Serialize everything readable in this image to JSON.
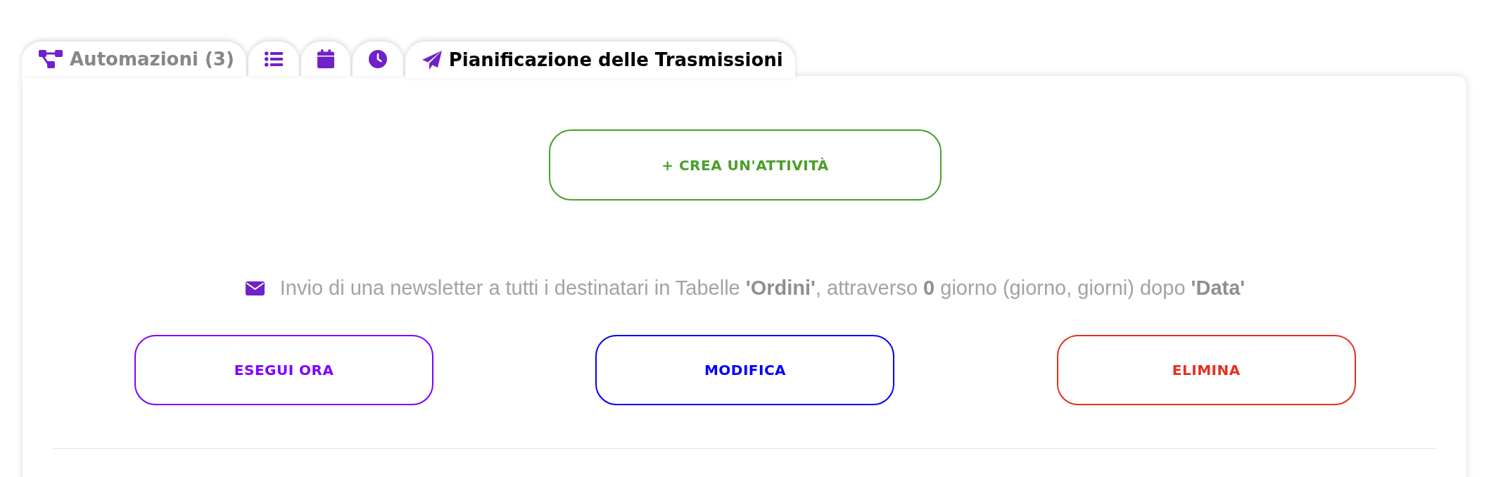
{
  "tabs": [
    {
      "label": "Automazioni (3)",
      "selected": false
    },
    {
      "selected": false
    },
    {
      "selected": false
    },
    {
      "selected": false
    },
    {
      "label": "Pianificazione delle Trasmissioni",
      "selected": true
    }
  ],
  "create_button": {
    "label": "+ CREA UN'ATTIVITÀ"
  },
  "task": {
    "description": "Invio di una newsletter a tutti i destinatari in Tabelle **'Ordini'**, attraverso **0** giorno (giorno, giorni) dopo **'Data'**",
    "actions": [
      {
        "label": "ESEGUI ORA",
        "color": "#7f00ff"
      },
      {
        "label": "MODIFICA",
        "color": "#0000f5"
      },
      {
        "label": "ELIMINA",
        "color": "#e5301f"
      }
    ]
  }
}
